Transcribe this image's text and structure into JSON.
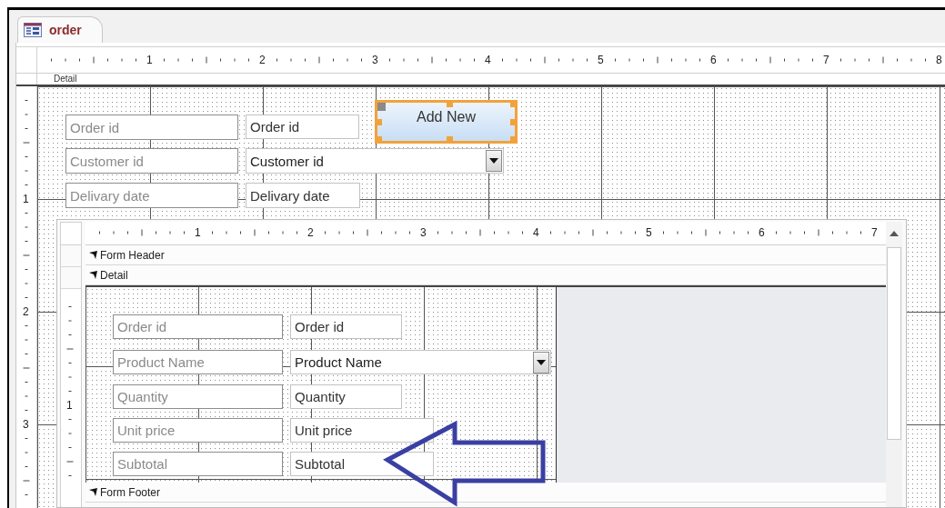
{
  "tab": {
    "title": "order"
  },
  "ruler": {
    "numbers": [
      "1",
      "2",
      "3",
      "4",
      "5",
      "6",
      "7",
      "8"
    ]
  },
  "vertical_ruler": {
    "numbers": [
      "1",
      "2",
      "3"
    ]
  },
  "section": {
    "title": "Detail"
  },
  "controls": [
    {
      "kind": "label",
      "text": "Order id",
      "selected": false
    },
    {
      "kind": "textbox",
      "text": "Order id",
      "selected": false
    },
    {
      "kind": "button",
      "text": "Add New",
      "selected": true
    },
    {
      "kind": "label",
      "text": "Customer id",
      "selected": false
    },
    {
      "kind": "combobox",
      "text": "Customer id",
      "selected": false
    },
    {
      "kind": "label",
      "text": "Delivary date",
      "selected": false
    },
    {
      "kind": "textbox",
      "text": "Delivary date",
      "selected": false
    }
  ],
  "subform": {
    "ruler": {
      "numbers": [
        "1",
        "2",
        "3",
        "4",
        "5",
        "6",
        "7"
      ]
    },
    "vertical_ruler": {
      "numbers": [
        "1"
      ]
    },
    "sections": [
      {
        "title": "Form Header"
      },
      {
        "title": "Detail",
        "controls": [
          {
            "kind": "label",
            "text": "Order id",
            "selected": false
          },
          {
            "kind": "textbox",
            "text": "Order id",
            "selected": false
          },
          {
            "kind": "label",
            "text": "Product Name",
            "selected": false
          },
          {
            "kind": "combobox",
            "text": "Product Name",
            "selected": false
          },
          {
            "kind": "label",
            "text": "Quantity",
            "selected": false
          },
          {
            "kind": "textbox",
            "text": "Quantity",
            "selected": false
          },
          {
            "kind": "label",
            "text": "Unit price",
            "selected": false
          },
          {
            "kind": "textbox",
            "text": "Unit price",
            "selected": false
          },
          {
            "kind": "label",
            "text": "Subtotal",
            "selected": false
          },
          {
            "kind": "textbox",
            "text": "Subtotal",
            "selected": false
          }
        ]
      },
      {
        "title": "Form Footer"
      }
    ]
  }
}
